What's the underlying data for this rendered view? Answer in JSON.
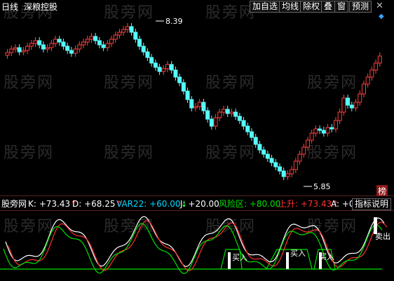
{
  "header": {
    "period": "日线",
    "stock_name": "深粮控股",
    "toolbar": [
      "加自选",
      "均线",
      "除权",
      "叠",
      "窗",
      "预测"
    ],
    "diamond_icon": "diamond-icon"
  },
  "price_chart": {
    "high_label": "8.39",
    "low_label": "5.85",
    "badge": "榜",
    "colors": {
      "up": "#ff4040",
      "down": "#54ffff",
      "axis": "#b04040"
    }
  },
  "indicator": {
    "name": "股旁网",
    "items": [
      {
        "label": "K: +73.43",
        "arrow": "↑",
        "color": "#ffffff"
      },
      {
        "label": "D: +68.25",
        "arrow": "↑",
        "color": "#ffffff"
      },
      {
        "label": "VAR22: +60.00",
        "arrow": "↓",
        "color": "#00d8ff"
      },
      {
        "label": "J: +20.00",
        "arrow": "",
        "color": "#ffffff"
      },
      {
        "label": "风险区: +80.00",
        "arrow": "",
        "color": "#00e000"
      },
      {
        "label": "上升: +73.43",
        "arrow": "↑",
        "color": "#ff3030"
      },
      {
        "label": "A: +0",
        "arrow": "",
        "color": "#ffffff"
      }
    ],
    "explain_button": "指标说明"
  },
  "oscillator": {
    "buy_label": "买入",
    "sell_label": "卖出",
    "risk_color": "#00e000"
  },
  "watermark": "股旁网"
}
